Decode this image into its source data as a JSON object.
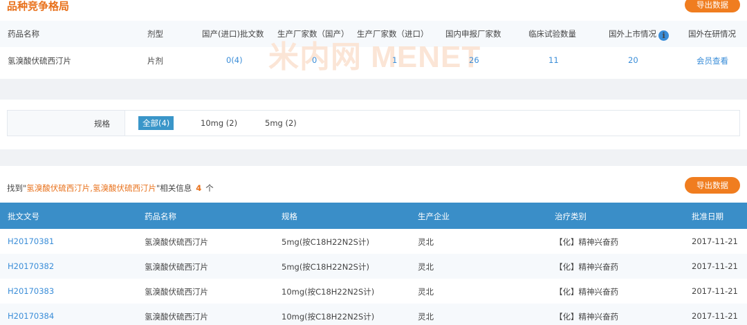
{
  "competition": {
    "title": "品种竞争格局",
    "export_label": "导出数据",
    "headers": [
      "药品名称",
      "剂型",
      "国产(进口)批文数",
      "生产厂家数（国产）",
      "生产厂家数（进口）",
      "国内申报厂家数",
      "临床试验数量",
      "国外上市情况",
      "国外在研情况"
    ],
    "info_icon": "i",
    "row": {
      "drug": "氢溴酸伏硫西汀片",
      "form": "片剂",
      "approvals": "0(4)",
      "domestic_makers": "0",
      "import_makers": "1",
      "domestic_applicants": "26",
      "clinical_trials": "11",
      "overseas_listed": "20",
      "overseas_research": "会员查看"
    },
    "watermark": "米内网 MENET"
  },
  "spec_filter": {
    "label": "规格",
    "options": [
      "全部(4)",
      "10mg (2)",
      "5mg (2)"
    ],
    "active_index": 0
  },
  "results": {
    "prefix": "找到\"",
    "query": "氢溴酸伏硫西汀片,氢溴酸伏硫西汀片",
    "suffix": "\"相关信息",
    "count": "4",
    "unit": "个",
    "export_label": "导出数据",
    "headers": [
      "批文文号",
      "药品名称",
      "规格",
      "生产企业",
      "治疗类别",
      "批准日期"
    ],
    "rows": [
      {
        "no": "H20170381",
        "name": "氢溴酸伏硫西汀片",
        "spec": "5mg(按C18H22N2S计)",
        "maker": "灵北",
        "category": "【化】精神兴奋药",
        "date": "2017-11-21"
      },
      {
        "no": "H20170382",
        "name": "氢溴酸伏硫西汀片",
        "spec": "5mg(按C18H22N2S计)",
        "maker": "灵北",
        "category": "【化】精神兴奋药",
        "date": "2017-11-21"
      },
      {
        "no": "H20170383",
        "name": "氢溴酸伏硫西汀片",
        "spec": "10mg(按C18H22N2S计)",
        "maker": "灵北",
        "category": "【化】精神兴奋药",
        "date": "2017-11-21"
      },
      {
        "no": "H20170384",
        "name": "氢溴酸伏硫西汀片",
        "spec": "10mg(按C18H22N2S计)",
        "maker": "灵北",
        "category": "【化】精神兴奋药",
        "date": "2017-11-21"
      }
    ]
  },
  "colors": {
    "accent_orange": "#f07d1f",
    "header_blue": "#3a8ec8",
    "link_blue": "#3a8dd8"
  }
}
